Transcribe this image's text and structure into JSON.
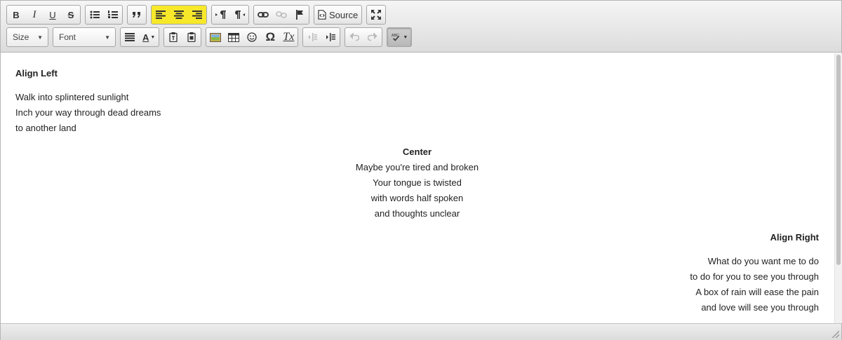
{
  "toolbar": {
    "row1": {
      "basicstyles": [
        "B",
        "I",
        "U",
        "S"
      ],
      "source_label": "Source"
    },
    "row2": {
      "size_label": "Size",
      "font_label": "Font",
      "text_color_label": "A",
      "special_char_label": "Ω",
      "remove_format_label": "Tx"
    },
    "highlight_color": "#f7e82a"
  },
  "content": {
    "left": {
      "heading": "Align Left",
      "lines": [
        "Walk into splintered sunlight",
        "Inch your way through dead dreams",
        "to another land"
      ]
    },
    "center": {
      "heading": "Center",
      "lines": [
        "Maybe you're tired and broken",
        "Your tongue is twisted",
        "with words half spoken",
        "and thoughts unclear"
      ]
    },
    "right": {
      "heading": "Align Right",
      "lines": [
        "What do you want me to do",
        "to do for you to see you through",
        "A box of rain will ease the pain",
        "and love will see you through"
      ]
    }
  }
}
